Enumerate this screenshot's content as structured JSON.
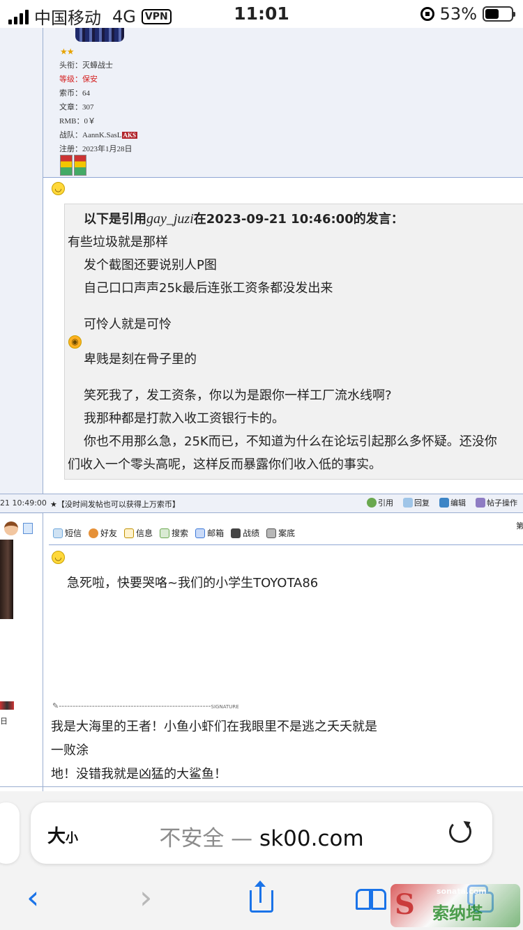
{
  "status_bar": {
    "carrier": "中国移动",
    "network": "4G",
    "vpn": "VPN",
    "time": "11:01",
    "battery": "53%"
  },
  "profile": {
    "title": "头衔：灭蟑战士",
    "level": "等级：保安",
    "coins": "索币：64",
    "posts": "文章：307",
    "rmb": "RMB：0￥",
    "team_label": "战队：AannK.SasL",
    "team_badge": "AKS",
    "registered": "注册：2023年1月28日"
  },
  "quote": {
    "header_prefix": "以下是引用",
    "header_user": "gay_juzi",
    "header_suffix": "在2023-09-21 10:46:00的发言：",
    "lines": [
      "有些垃圾就是那样",
      "发个截图还要说别人P图",
      "自己口口声声25k最后连张工资条都没发出来",
      "可怜人就是可怜",
      "卑贱是刻在骨子里的",
      "笑死我了，发工资条，你以为是跟你一样工厂流水线啊?",
      "我那种都是打款入收工资银行卡的。",
      "你也不用那么急，25K而已，不知道为什么在论坛引起那么多怀疑。还没你",
      "们收入一个零头高呢，这样反而暴露你们收入低的事实。"
    ]
  },
  "post_bar": {
    "date": "21 10:49:00",
    "notice": "★【没时间发帖也可以获得上万索币】",
    "actions": [
      "引用",
      "回复",
      "编辑",
      "帖子操作"
    ]
  },
  "post2": {
    "page_label": "第",
    "side_text": "日",
    "tools": [
      "短信",
      "好友",
      "信息",
      "搜索",
      "邮箱",
      "战绩",
      "案底"
    ],
    "message": "急死啦，快要哭咯~我们的小学生TOYOTA86",
    "signature_label": "SIGNATURE",
    "signature_lines": [
      "我是大海里的王者！小鱼小虾们在我眼里不是逃之夭夭就是",
      "一败涂",
      "地！没错我就是凶猛的大鲨鱼！"
    ]
  },
  "browser": {
    "text_size": "大",
    "text_size_small": "小",
    "insecure": "不安全 — ",
    "domain": "sk00.com"
  },
  "watermark": {
    "site": "sonata.com",
    "name": "索纳塔"
  }
}
